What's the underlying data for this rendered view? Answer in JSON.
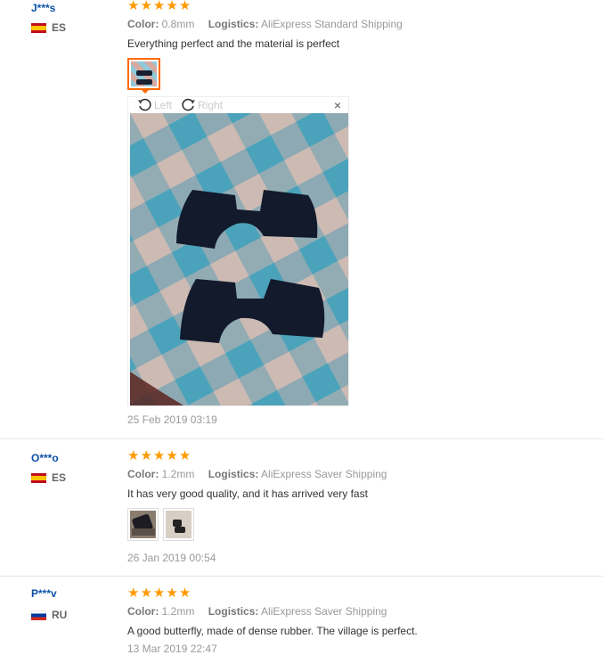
{
  "reviews": [
    {
      "user": "J***s",
      "country": "ES",
      "stars": 5,
      "color_label": "Color:",
      "color_value": "0.8mm",
      "logistics_label": "Logistics:",
      "logistics_value": "AliExpress Standard Shipping",
      "text": "Everything perfect and the material is perfect",
      "date": "25 Feb 2019 03:19"
    },
    {
      "user": "O***o",
      "country": "ES",
      "stars": 5,
      "color_label": "Color:",
      "color_value": "1.2mm",
      "logistics_label": "Logistics:",
      "logistics_value": "AliExpress Saver Shipping",
      "text": "It has very good quality, and it has arrived very fast",
      "date": "26 Jan 2019 00:54"
    },
    {
      "user": "P***v",
      "country": "RU",
      "stars": 5,
      "color_label": "Color:",
      "color_value": "1.2mm",
      "logistics_label": "Logistics:",
      "logistics_value": "AliExpress Saver Shipping",
      "text": "A good butterfly, made of dense rubber. The village is perfect.",
      "date": "13 Mar 2019 22:47"
    }
  ],
  "viewer": {
    "rotate_left": "Left",
    "rotate_right": "Right",
    "close": "×"
  },
  "icons": {
    "star": "star-icon",
    "rotate_left": "rotate-left-icon",
    "rotate_right": "rotate-right-icon",
    "close": "close-icon"
  },
  "colors": {
    "user_link": "#0b50a8",
    "star": "#ff9a00",
    "active_thumb": "#ff6a00"
  }
}
